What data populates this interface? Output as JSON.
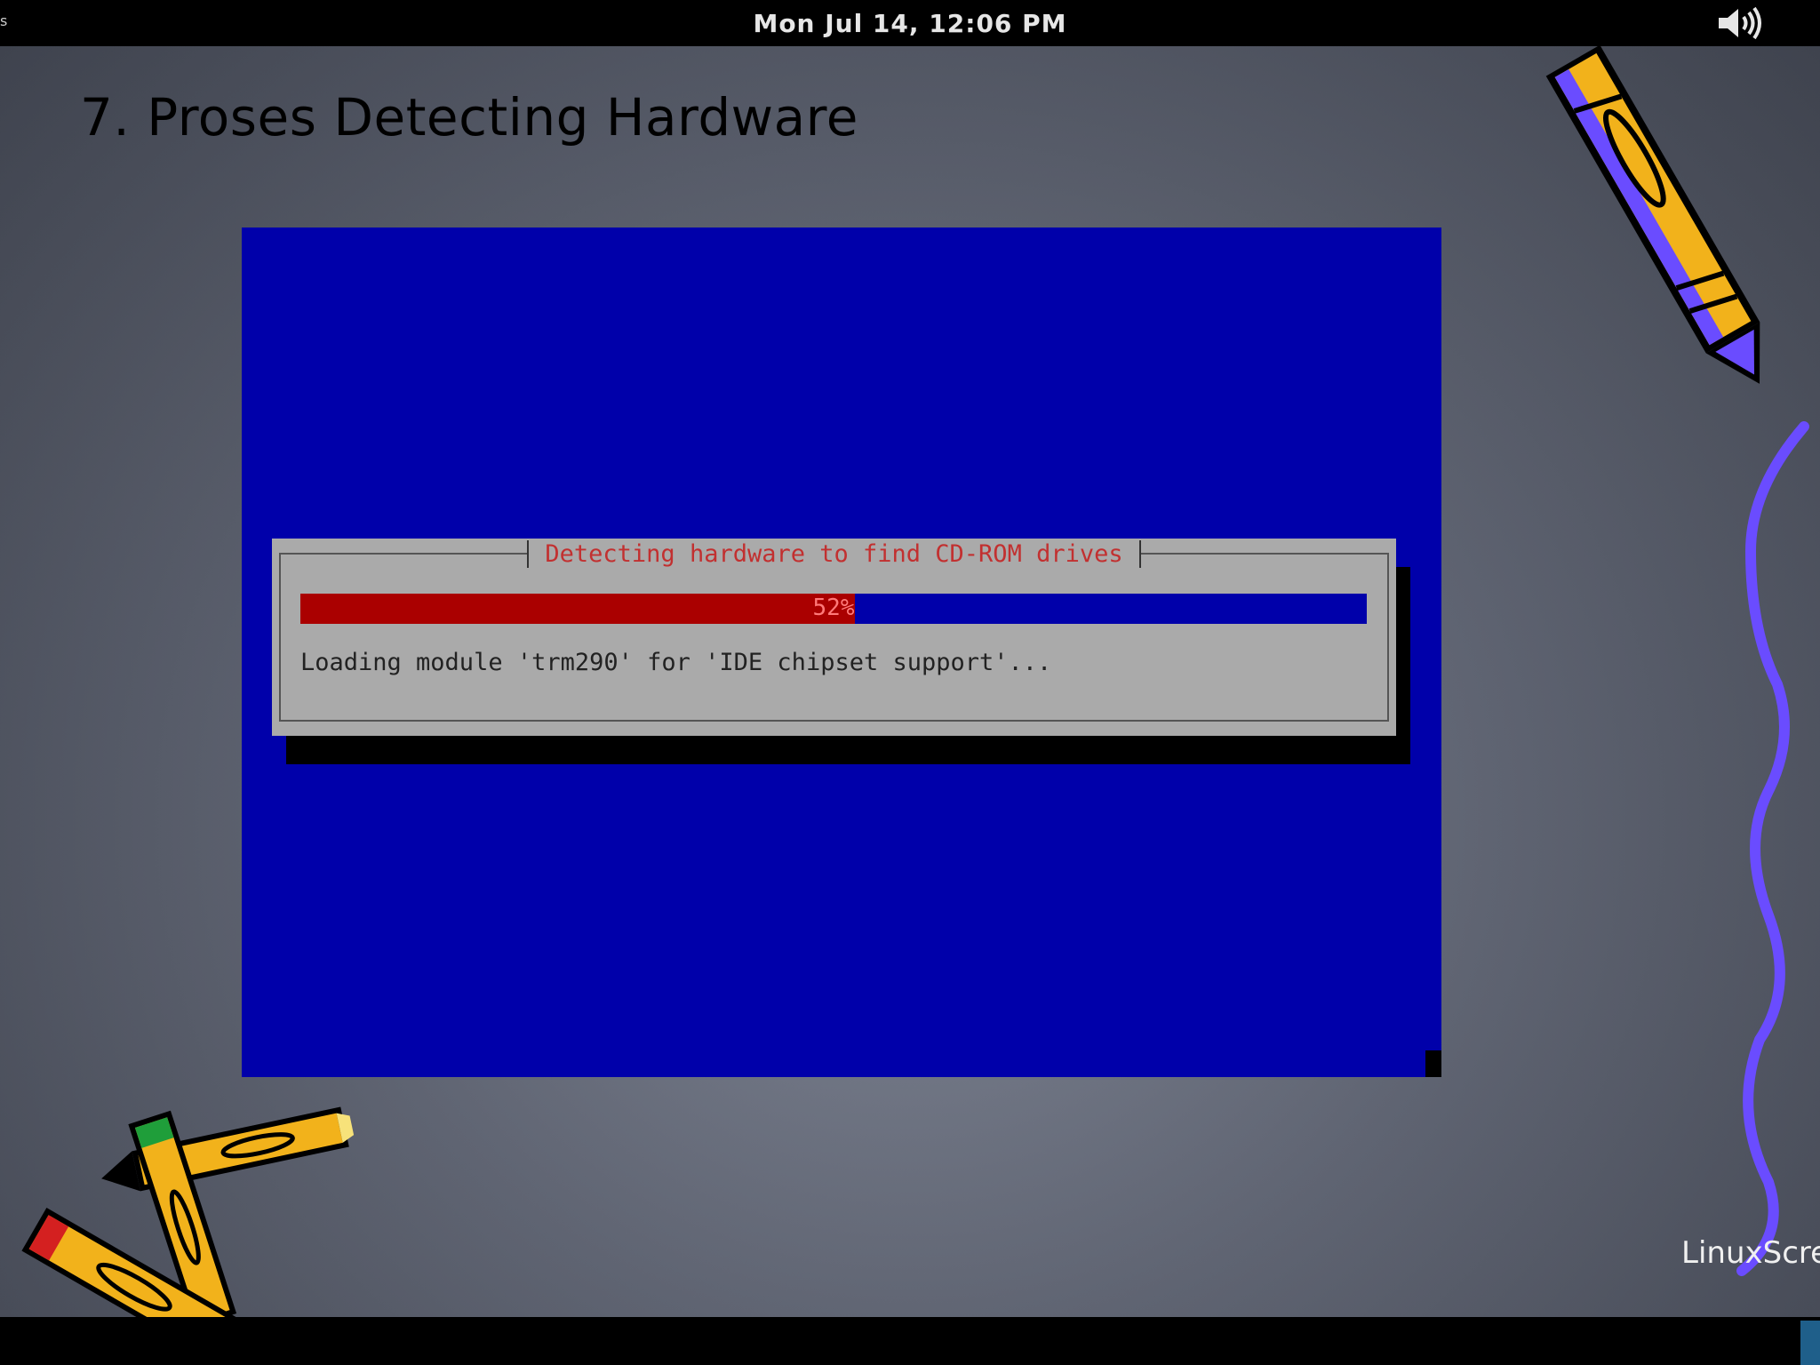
{
  "top_bar": {
    "edge_glyph": "s",
    "clock": "Mon Jul 14, 12:06 PM",
    "volume_icon": "speaker-volume-icon"
  },
  "slide": {
    "title": "7. Proses Detecting Hardware"
  },
  "installer": {
    "dialog_title": "Detecting hardware to find CD-ROM drives",
    "progress_percent": 52,
    "progress_label": "52%",
    "status_text": "Loading module 'trm290' for 'IDE chipset support'..."
  },
  "watermark": "LinuxScre",
  "colors": {
    "installer_background": "#0000aa",
    "dialog_background": "#aaaaaa",
    "progress_fill": "#aa0000",
    "dialog_title_text": "#c23030",
    "squiggle": "#6a4cff",
    "pencil_body": "#f2b21b"
  }
}
